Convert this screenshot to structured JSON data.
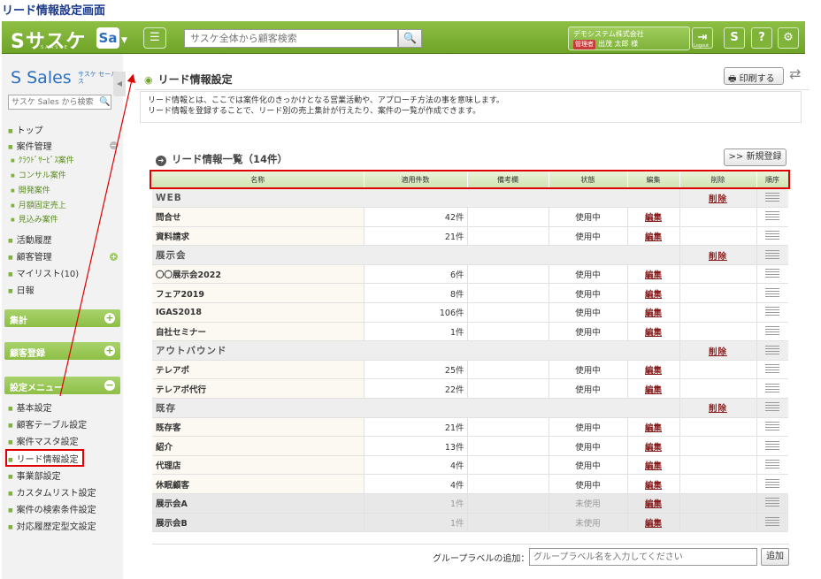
{
  "doc_title": "リード情報設定画面",
  "header": {
    "logo": "Sサスケ",
    "logo_sub": "SAASKE",
    "app_switch": "Sa",
    "search_placeholder": "サスケ全体から顧客検索",
    "company": "デモシステム株式会社",
    "role_badge": "管理者",
    "user": "出茂 太郎 様",
    "logout": "Logout",
    "help": "?"
  },
  "sidebar": {
    "product": "Sales",
    "product_sub": "サスケ セールス",
    "search_placeholder": "サスケ Sales から検索",
    "items": [
      {
        "label": "トップ"
      },
      {
        "label": "案件管理"
      },
      {
        "label": "ｸﾗｳﾄﾞｻｰﾋﾞｽ案件"
      },
      {
        "label": "コンサル案件"
      },
      {
        "label": "開発案件"
      },
      {
        "label": "月額固定売上"
      },
      {
        "label": "見込み案件"
      },
      {
        "label": "活動履歴"
      },
      {
        "label": "顧客管理"
      },
      {
        "label": "マイリスト(10)"
      },
      {
        "label": "日報"
      }
    ],
    "sections": [
      "集計",
      "顧客登録",
      "設定メニュー"
    ],
    "settings": [
      {
        "label": "基本設定"
      },
      {
        "label": "顧客テーブル設定"
      },
      {
        "label": "案件マスタ設定"
      },
      {
        "label": "リード情報設定"
      },
      {
        "label": "事業部設定"
      },
      {
        "label": "カスタムリスト設定"
      },
      {
        "label": "案件の検索条件設定"
      },
      {
        "label": "対応履歴定型文設定"
      }
    ]
  },
  "main": {
    "title": "リード情報設定",
    "print_label": "印刷する",
    "desc_1": "リード情報とは、ここでは案件化のきっかけとなる営業活動や、アプローチ方法の事を意味します。",
    "desc_2": "リード情報を登録することで、リード別の売上集計が行えたり、案件の一覧が作成できます。",
    "list_title": "リード情報一覧（14件）",
    "new_button": ">> 新規登録",
    "columns": [
      "名称",
      "適用件数",
      "備考欄",
      "状態",
      "編集",
      "削除",
      "順序"
    ],
    "edit_label": "編集",
    "delete_label": "削除",
    "groups": [
      {
        "name": "WEB",
        "items": [
          {
            "name": "問合せ",
            "count": "42件",
            "state": "使用中"
          },
          {
            "name": "資料請求",
            "count": "21件",
            "state": "使用中"
          }
        ]
      },
      {
        "name": "展示会",
        "items": [
          {
            "name": "〇〇展示会2022",
            "count": "6件",
            "state": "使用中"
          },
          {
            "name": "フェア2019",
            "count": "8件",
            "state": "使用中"
          },
          {
            "name": "IGAS2018",
            "count": "106件",
            "state": "使用中"
          },
          {
            "name": "自社セミナー",
            "count": "1件",
            "state": "使用中"
          }
        ]
      },
      {
        "name": "アウトバウンド",
        "items": [
          {
            "name": "テレアポ",
            "count": "25件",
            "state": "使用中"
          },
          {
            "name": "テレアポ代行",
            "count": "22件",
            "state": "使用中"
          }
        ]
      },
      {
        "name": "既存",
        "items": [
          {
            "name": "既存客",
            "count": "21件",
            "state": "使用中"
          },
          {
            "name": "紹介",
            "count": "13件",
            "state": "使用中"
          },
          {
            "name": "代理店",
            "count": "4件",
            "state": "使用中"
          },
          {
            "name": "休眠顧客",
            "count": "4件",
            "state": "使用中"
          },
          {
            "name": "展示会A",
            "count": "1件",
            "state": "未使用"
          },
          {
            "name": "展示会B",
            "count": "1件",
            "state": "未使用"
          }
        ]
      }
    ],
    "add_label": "グループラベルの追加：",
    "add_placeholder": "グループラベル名を入力してください",
    "add_button": "追加"
  },
  "colors": {
    "accent_green": "#7fb33a",
    "highlight_red": "#e00000",
    "link_red": "#8b1b1b"
  }
}
